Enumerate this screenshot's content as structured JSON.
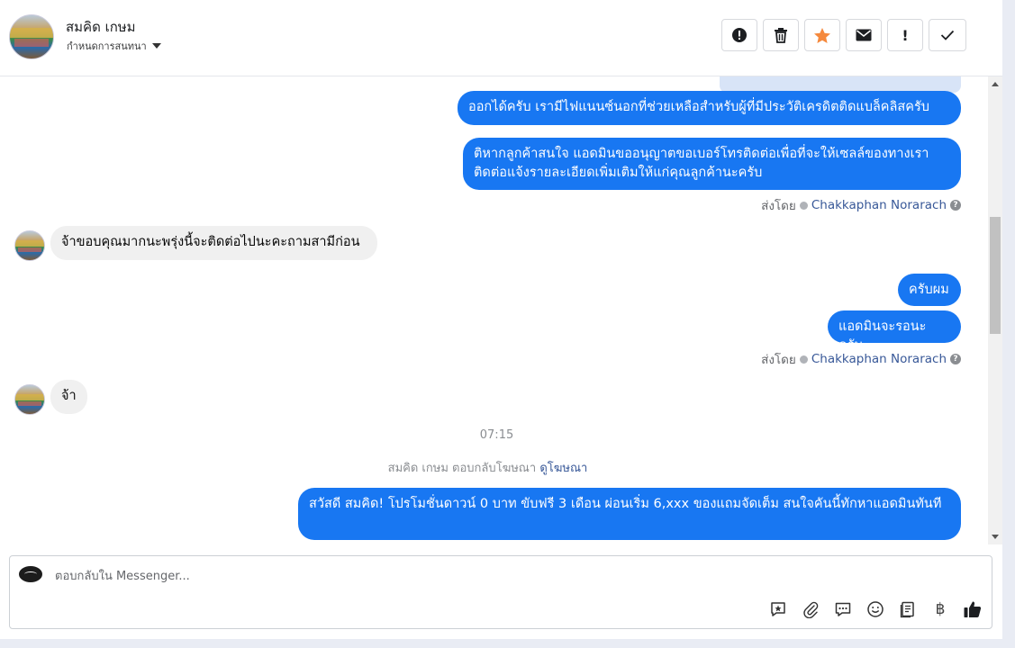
{
  "header": {
    "name": "สมคิด เกษม",
    "subtitle": "กำหนดการสนทนา"
  },
  "toolbar": {
    "spam_label": "!",
    "flag_label": "!"
  },
  "messages": {
    "out1": "ออกได้ครับ เรามีไฟแนนซ์นอกที่ช่วยเหลือสำหรับผู้ที่มีประวัติเครดิตติดแบล็คลิสครับ",
    "out2": "ติหากลูกค้าสนใจ แอดมินขออนุญาตขอเบอร์โทรติดต่อเพื่อที่จะให้เซลล์ของทางเราติดต่อแจ้งรายละเอียดเพิ่มเติมให้แก่คุณลูกค้านะครับ",
    "in1": "จ้าขอบคุณมากนะพรุ่งนี้จะติดต่อไปนะคะถามสามีก่อน",
    "out3": "ครับผม",
    "out4": "แอดมินจะรอนะครับ",
    "in2": "จ้า",
    "out5": "สวัสดี สมคิด! โปรโมชั่นดาวน์ 0 บาท ขับฟรี 3 เดือน ผ่อนเริ่ม 6,xxx ของแถมจัดเต็ม สนใจคันนี้ทักหาแอดมินทันที"
  },
  "sent_by": {
    "prefix": "ส่งโดย",
    "name": "Chakkaphan Norarach"
  },
  "timestamp": "07:15",
  "ad_reply": {
    "text": "สมคิด เกษม ตอบกลับโฆษณา",
    "link": "ดูโฆษณา"
  },
  "composer": {
    "placeholder": "ตอบกลับใน Messenger..."
  },
  "composer_tools": {
    "baht": "฿"
  },
  "colors": {
    "accent": "#1877f2",
    "star": "#f5893d",
    "incoming_bubble": "#f0f0f0"
  }
}
